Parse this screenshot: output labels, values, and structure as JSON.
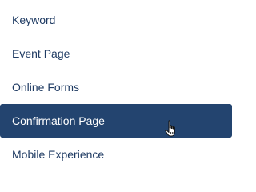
{
  "sidebar": {
    "items": [
      {
        "label": "Keyword",
        "active": false
      },
      {
        "label": "Event Page",
        "active": false
      },
      {
        "label": "Online Forms",
        "active": false
      },
      {
        "label": "Confirmation Page",
        "active": true
      },
      {
        "label": "Mobile Experience",
        "active": false
      }
    ]
  },
  "cursor": {
    "icon": "hand-pointer-icon"
  },
  "colors": {
    "text": "#1f3b63",
    "active_background": "#23446f",
    "active_text": "#ffffff"
  }
}
